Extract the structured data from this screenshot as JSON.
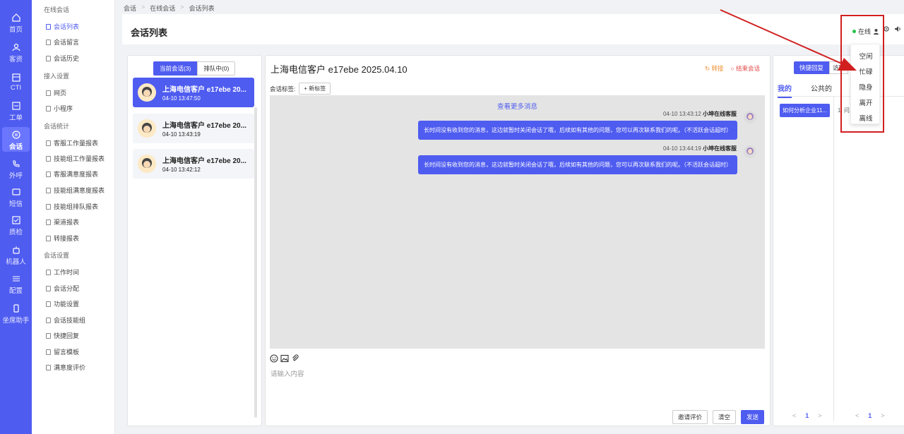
{
  "rail": [
    {
      "label": "首页",
      "icon": "home-icon"
    },
    {
      "label": "客资",
      "icon": "contacts-icon"
    },
    {
      "label": "CTI",
      "icon": "cti-icon"
    },
    {
      "label": "工单",
      "icon": "ticket-icon"
    },
    {
      "label": "会话",
      "icon": "chat-icon"
    },
    {
      "label": "外呼",
      "icon": "outbound-call-icon"
    },
    {
      "label": "短信",
      "icon": "sms-icon"
    },
    {
      "label": "质检",
      "icon": "quality-icon"
    },
    {
      "label": "机器人",
      "icon": "robot-icon"
    },
    {
      "label": "配置",
      "icon": "settings-sliders-icon"
    },
    {
      "label": "坐席助手",
      "icon": "agent-assistant-icon"
    }
  ],
  "submenu": {
    "g1": "在线会话",
    "i1": "会话列表",
    "i2": "会话留言",
    "i3": "会话历史",
    "g2": "接入设置",
    "i4": "网页",
    "i5": "小程序",
    "g3": "会话统计",
    "i6": "客服工作量报表",
    "i7": "技能组工作量报表",
    "i8": "客服满意度报表",
    "i9": "技能组满意度报表",
    "i10": "技能组排队报表",
    "i11": "渠道报表",
    "i12": "转接报表",
    "g4": "会话设置",
    "i13": "工作时间",
    "i14": "会话分配",
    "i15": "功能设置",
    "i16": "会话技能组",
    "i17": "快捷回复",
    "i18": "留言模板",
    "i19": "满意度评价"
  },
  "breadcrumb": {
    "c1": "会话",
    "c2": "在线会话",
    "c3": "会话列表",
    "sep": ">"
  },
  "header": {
    "title": "会话列表",
    "status": "在线",
    "status_color": "#27c24c"
  },
  "list": {
    "tab_current": "当前会话(3)",
    "tab_queue": "排队中(0)",
    "items": [
      {
        "name": "上海电信客户 e17ebe 20...",
        "time": "04-10 13:47:50"
      },
      {
        "name": "上海电信客户 e17ebe 20...",
        "time": "04-10 13:43:19"
      },
      {
        "name": "上海电信客户 e17ebe 20...",
        "time": "04-10 13:42:12"
      }
    ]
  },
  "chat": {
    "title": "上海电信客户 e17ebe 2025.04.10",
    "transfer": "转接",
    "end": "结束会话",
    "tag_label": "会话标签:",
    "new_tag": "+ 新标签",
    "more": "查看更多消息",
    "messages": [
      {
        "time": "04-10 13:43:12",
        "sender": "小坤在线客服",
        "text": "长时间没有收到您的消息，这边就暂时关闭会话了哦，后续如有其他的问题，您可以再次联系我们的呢。（不活跃会话超时）"
      },
      {
        "time": "04-10 13:44:19",
        "sender": "小坤在线客服",
        "text": "长时间没有收到您的消息，这边就暂时关闭会话了哦，后续如有其他的问题，您可以再次联系我们的呢。（不活跃会话超时）"
      }
    ],
    "placeholder": "请输入内容",
    "btn_invite": "邀请评价",
    "btn_clear": "清空",
    "btn_send": "发送"
  },
  "quick": {
    "tab_quick": "快捷回复",
    "tab_visitor": "访客",
    "sub_mine": "我的",
    "sub_public": "公共的",
    "chip": "如何分析企业11...",
    "chip2": "1. 问...认...",
    "pager_prev": "<",
    "pager_page": "1",
    "pager_next": ">"
  },
  "dropdown": [
    "空闲",
    "忙碌",
    "隐身",
    "离开",
    "离线"
  ],
  "colors": {
    "accent": "#4f5cf0",
    "highlight": "#d11f1f"
  }
}
